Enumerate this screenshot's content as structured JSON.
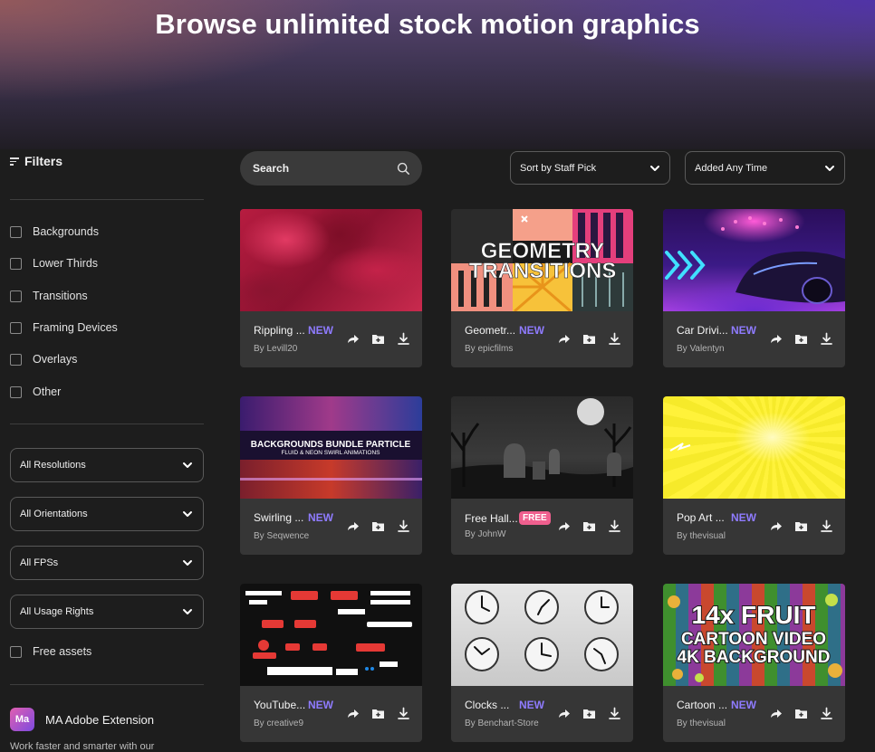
{
  "hero": {
    "title": "Browse unlimited stock motion graphics"
  },
  "sidebar": {
    "filters_label": "Filters",
    "categories": [
      "Backgrounds",
      "Lower Thirds",
      "Transitions",
      "Framing Devices",
      "Overlays",
      "Other"
    ],
    "dropdowns": [
      "All Resolutions",
      "All Orientations",
      "All FPSs",
      "All Usage Rights"
    ],
    "free_assets_label": "Free assets",
    "extension": {
      "logo": "Ma",
      "title": "MA Adobe Extension",
      "desc": "Work faster and smarter with our"
    }
  },
  "toolbar": {
    "search_placeholder": "Search",
    "sort_label": "Sort by Staff Pick",
    "time_label": "Added Any Time"
  },
  "cards": [
    {
      "title": "Rippling ...",
      "badge": "NEW",
      "author": "By Levill20"
    },
    {
      "title": "Geometr...",
      "badge": "NEW",
      "author": "By epicfilms"
    },
    {
      "title": "Car Drivi...",
      "badge": "NEW",
      "author": "By Valentyn"
    },
    {
      "title": "Swirling ...",
      "badge": "NEW",
      "author": "By Seqwence"
    },
    {
      "title": "Free Hall...",
      "badge": "FREE",
      "author": "By JohnW"
    },
    {
      "title": "Pop Art ...",
      "badge": "NEW",
      "author": "By thevisual"
    },
    {
      "title": "YouTube...",
      "badge": "NEW",
      "author": "By creative9"
    },
    {
      "title": "Clocks ...",
      "badge": "NEW",
      "author": "By Benchart-Store"
    },
    {
      "title": "Cartoon ...",
      "badge": "NEW",
      "author": "By thevisual"
    }
  ],
  "thumb_text": {
    "geometry_line1": "GEOMETRY",
    "geometry_line2": "TRANSITIONS",
    "bundle_line1": "BACKGROUNDS BUNDLE PARTICLE",
    "bundle_line2": "FLUID & NEON SWIRL ANIMATIONS",
    "fruit_line1": "14x FRUIT",
    "fruit_line2": "CARTOON VIDEO",
    "fruit_line3": "4K BACKGROUND"
  },
  "colors": {
    "accent": "#8f7bff",
    "free": "#ef5f8e",
    "card_bg": "#363636",
    "page_bg": "#1d1d1d"
  }
}
